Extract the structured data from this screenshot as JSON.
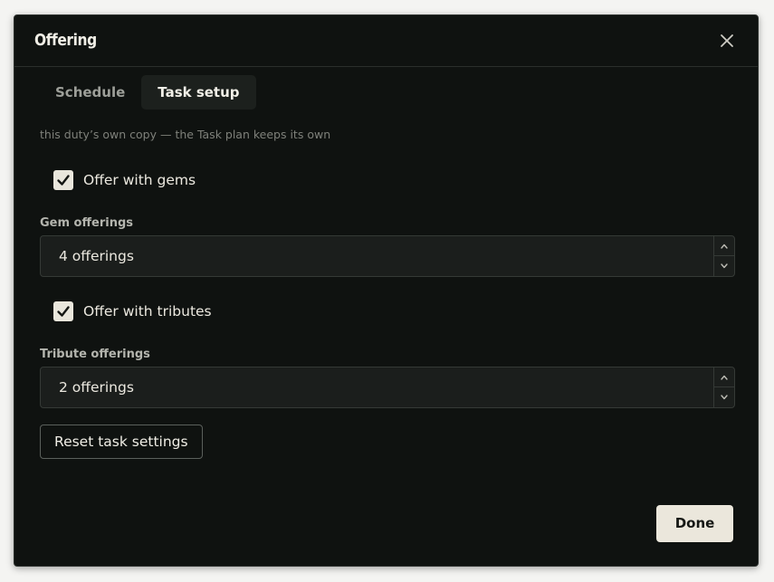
{
  "dialog": {
    "title": "Offering",
    "close_icon": "close-icon"
  },
  "tabs": [
    {
      "label": "Schedule",
      "active": false
    },
    {
      "label": "Task setup",
      "active": true
    }
  ],
  "hint": "this duty’s own copy — the Task plan keeps its own",
  "gems": {
    "checkbox_label": "Offer with gems",
    "checked": true,
    "field_label": "Gem offerings",
    "value": "4 offerings"
  },
  "tributes": {
    "checkbox_label": "Offer with tributes",
    "checked": true,
    "field_label": "Tribute offerings",
    "value": "2 offerings"
  },
  "buttons": {
    "reset": "Reset task settings",
    "done": "Done"
  },
  "colors": {
    "dialog_bg": "#0f1210",
    "accent_button": "#ebe7dc",
    "text": "#e6e4dc"
  }
}
